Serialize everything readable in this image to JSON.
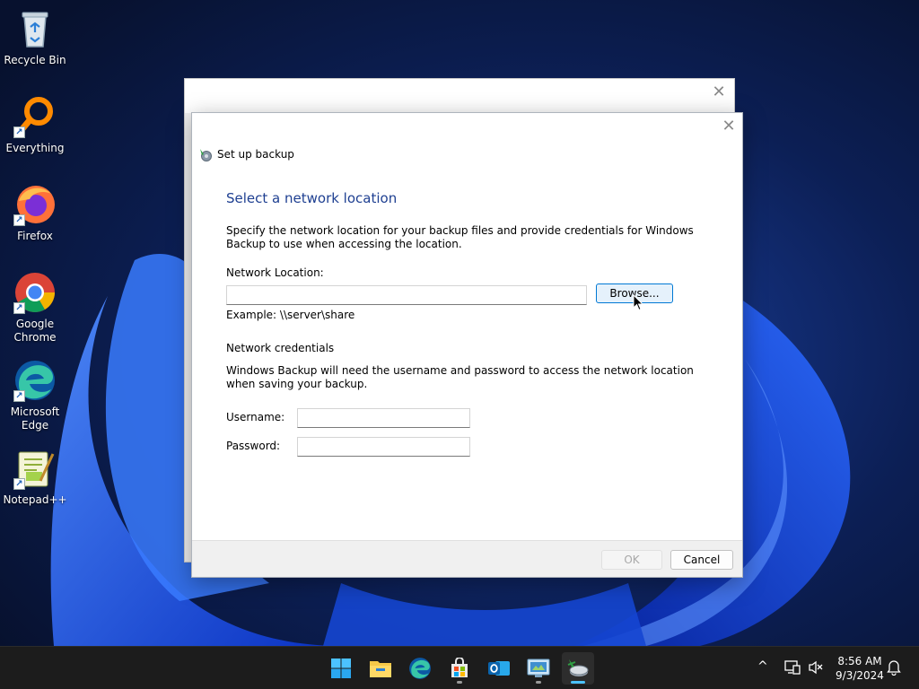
{
  "desktop": {
    "icons": [
      {
        "label": "Recycle Bin"
      },
      {
        "label": "Everything"
      },
      {
        "label": "Firefox"
      },
      {
        "label": "Google Chrome"
      },
      {
        "label": "Microsoft Edge"
      },
      {
        "label": "Notepad++"
      }
    ]
  },
  "dialog": {
    "title": "Set up backup",
    "heading": "Select a network location",
    "description": "Specify the network location for your backup files and provide credentials for Windows Backup to use when accessing the location.",
    "network_location_label": "Network Location:",
    "network_location_value": "",
    "browse_label": "Browse...",
    "example": "Example: \\\\server\\share",
    "credentials_heading": "Network credentials",
    "credentials_text": "Windows Backup will need the username and password to access the network location when saving your backup.",
    "username_label": "Username:",
    "username_value": "",
    "password_label": "Password:",
    "password_value": "",
    "ok_label": "OK",
    "cancel_label": "Cancel",
    "close_glyph": "✕"
  },
  "back_window": {
    "close_glyph": "✕"
  },
  "taskbar": {
    "apps": [
      {
        "name": "start-button",
        "icon": "windows-logo-icon"
      },
      {
        "name": "file-explorer",
        "icon": "folder-icon"
      },
      {
        "name": "edge",
        "icon": "edge-icon"
      },
      {
        "name": "store",
        "icon": "store-icon"
      },
      {
        "name": "outlook",
        "icon": "outlook-icon"
      },
      {
        "name": "control-panel",
        "icon": "control-panel-icon"
      },
      {
        "name": "backup",
        "icon": "backup-icon"
      }
    ],
    "time": "8:56 AM",
    "date": "9/3/2024",
    "chevron_glyph": "^"
  },
  "colors": {
    "heading": "#1e3f91",
    "accent": "#0078d4",
    "taskbar": "#1c1c1c"
  }
}
